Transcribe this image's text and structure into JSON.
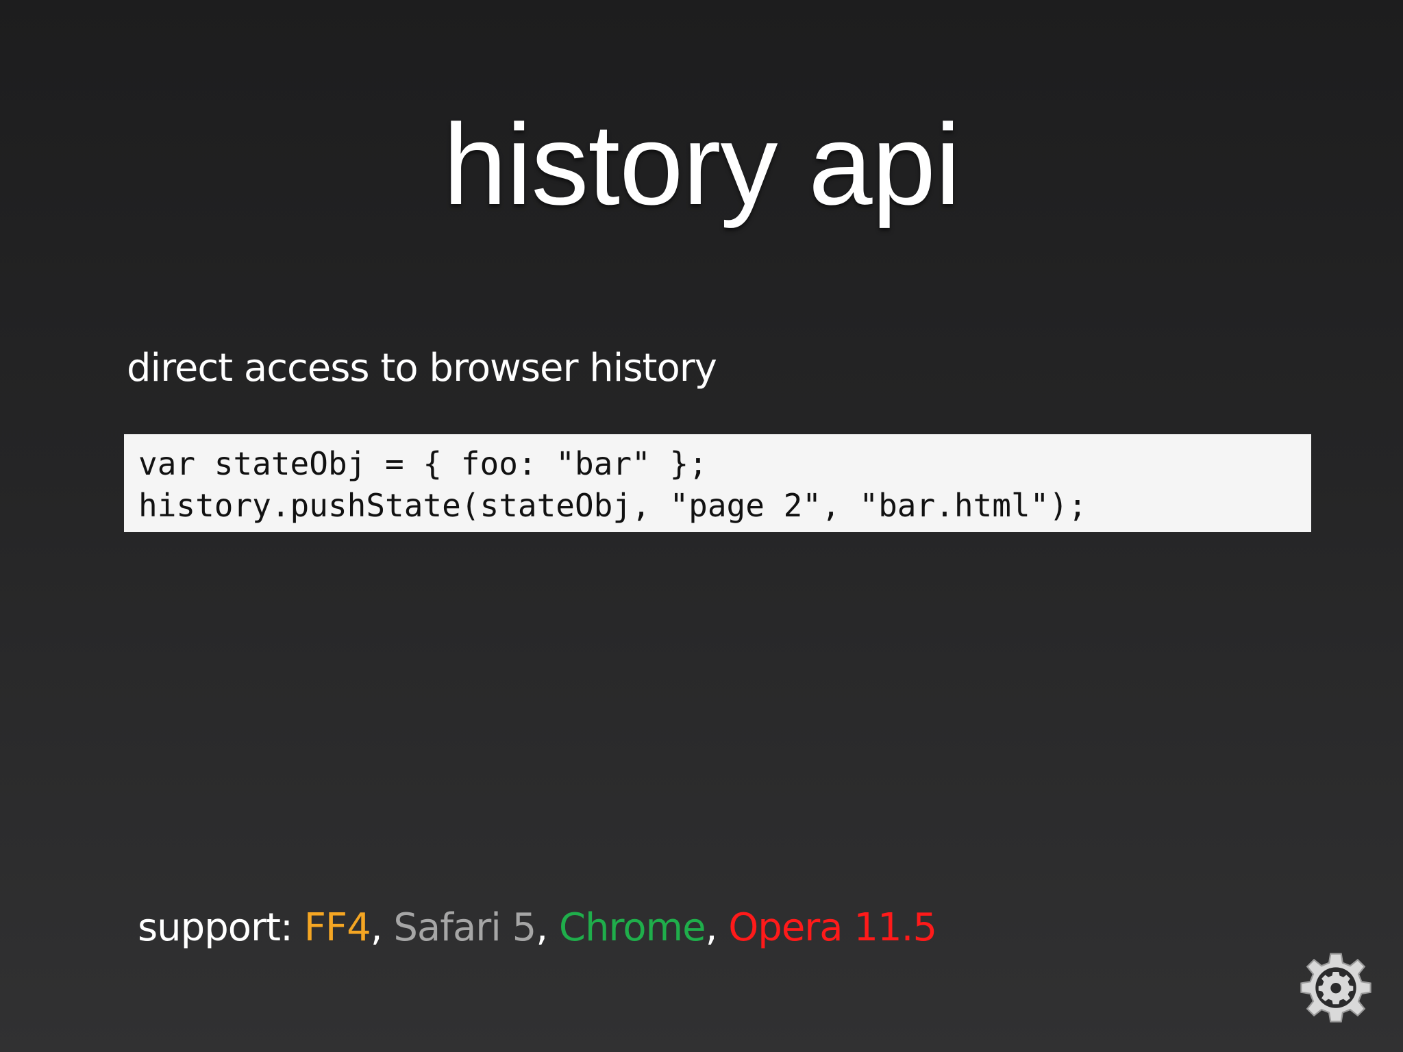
{
  "slide": {
    "title": "history api",
    "subtitle": "direct access to browser history"
  },
  "code": {
    "lines": [
      "var stateObj = { foo: \"bar\" };",
      "history.pushState(stateObj, \"page 2\", \"bar.html\");"
    ]
  },
  "support": {
    "label": "support:",
    "separator": ",",
    "browsers": [
      {
        "name": "FF4",
        "color": "#f5a623"
      },
      {
        "name": "Safari 5",
        "color": "#a6a6a6"
      },
      {
        "name": "Chrome",
        "color": "#1fae4b"
      },
      {
        "name": "Opera 11.5",
        "color": "#ff1a1a"
      }
    ]
  },
  "icons": {
    "corner": "gear-icon"
  }
}
